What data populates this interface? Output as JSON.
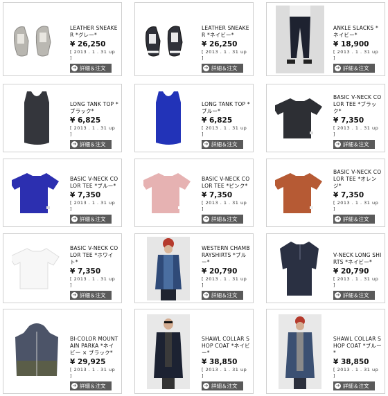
{
  "button_label": "詳細＆注文",
  "button_icon": "arrow-right-icon",
  "products": [
    {
      "name": "LEATHER SNEAKER *グレー*",
      "price": "¥ 26,250",
      "date": "[ 2013 . 1 . 31 up ]",
      "image": "sneaker-grey"
    },
    {
      "name": "LEATHER SNEAKER *ネイビー*",
      "price": "¥ 26,250",
      "date": "[ 2013 . 1 . 31 up ]",
      "image": "sneaker-navy"
    },
    {
      "name": "ANKLE SLACKS *ネイビー*",
      "price": "¥ 18,900",
      "date": "[ 2013 . 1 . 31 up ]",
      "image": "model-slacks"
    },
    {
      "name": "LONG TANK TOP *ブラック*",
      "price": "¥ 6,825",
      "date": "[ 2013 . 1 . 31 up ]",
      "image": "tank-black"
    },
    {
      "name": "LONG TANK TOP *ブルー*",
      "price": "¥ 6,825",
      "date": "[ 2013 . 1 . 31 up ]",
      "image": "tank-blue"
    },
    {
      "name": "BASIC V-NECK COLOR TEE *ブラック*",
      "price": "¥ 7,350",
      "date": "[ 2013 . 1 . 31 up ]",
      "image": "tee-black"
    },
    {
      "name": "BASIC V-NECK COLOR TEE *ブルー*",
      "price": "¥ 7,350",
      "date": "[ 2013 . 1 . 31 up ]",
      "image": "tee-blue"
    },
    {
      "name": "BASIC V-NECK COLOR TEE *ピンク*",
      "price": "¥ 7,350",
      "date": "[ 2013 . 1 . 31 up ]",
      "image": "tee-pink"
    },
    {
      "name": "BASIC V-NECK COLOR TEE *オレンジ*",
      "price": "¥ 7,350",
      "date": "[ 2013 . 1 . 31 up ]",
      "image": "tee-orange"
    },
    {
      "name": "BASIC V-NECK COLOR TEE *ホワイト*",
      "price": "¥ 7,350",
      "date": "[ 2013 . 1 . 31 up ]",
      "image": "tee-white"
    },
    {
      "name": "WESTERN CHAMBRAYSHIRTS *ブルー*",
      "price": "¥ 20,790",
      "date": "[ 2013 . 1 . 31 up ]",
      "image": "model-chambray"
    },
    {
      "name": "V-NECK LONG SHIRTS *ネイビー*",
      "price": "¥ 20,790",
      "date": "[ 2013 . 1 . 31 up ]",
      "image": "longshirt-navy"
    },
    {
      "name": "BI-COLOR MOUNTAIN PARKA *ネイビー × ブラック*",
      "price": "¥ 29,925",
      "date": "[ 2013 . 1 . 31 up ]",
      "image": "parka"
    },
    {
      "name": "SHAWL COLLAR SHOP COAT *ネイビー*",
      "price": "¥ 38,850",
      "date": "[ 2013 . 1 . 31 up ]",
      "image": "model-coat-navy"
    },
    {
      "name": "SHAWL COLLAR SHOP COAT *ブルー*",
      "price": "¥ 38,850",
      "date": "[ 2013 . 1 . 31 up ]",
      "image": "model-coat-blue"
    }
  ]
}
